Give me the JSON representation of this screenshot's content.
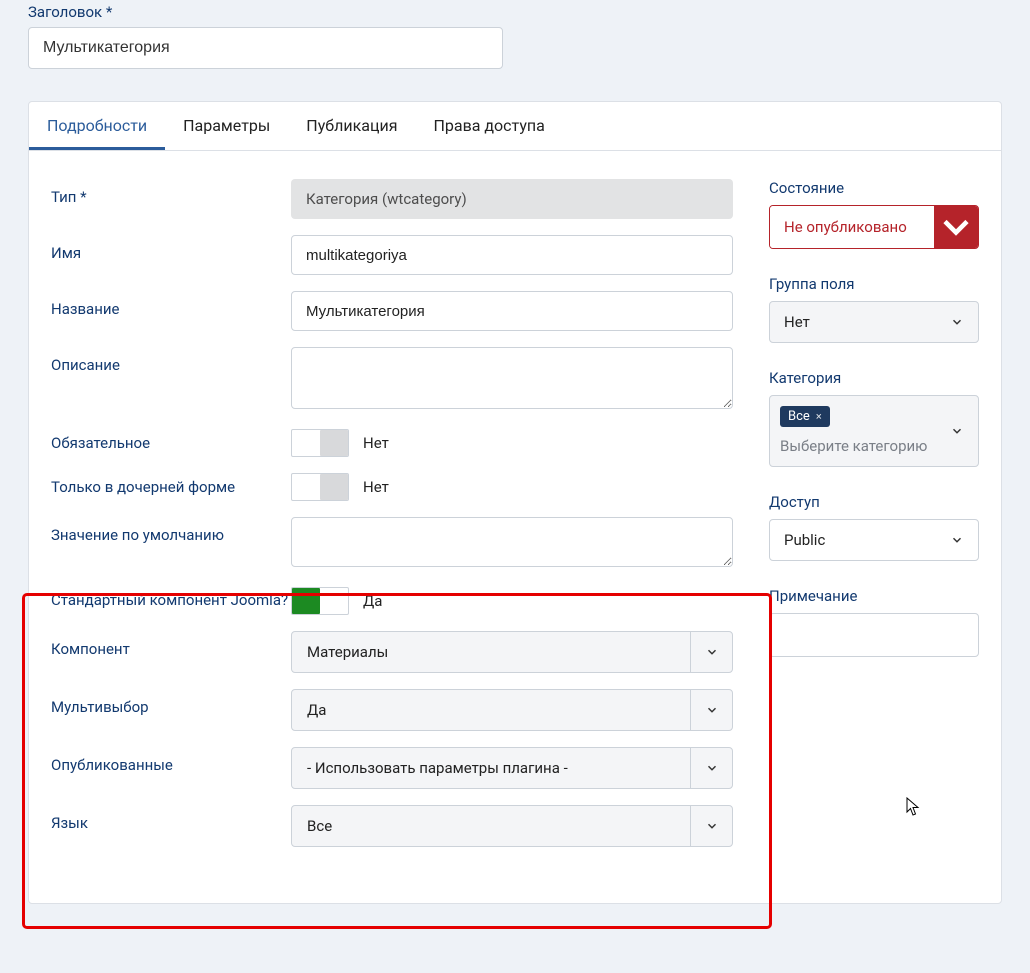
{
  "header": {
    "title_label": "Заголовок *",
    "title_value": "Мультикатегория"
  },
  "tabs": {
    "details": "Подробности",
    "params": "Параметры",
    "publication": "Публикация",
    "permissions": "Права доступа"
  },
  "main": {
    "type_label": "Тип *",
    "type_value": "Категория (wtcategory)",
    "name_label": "Имя",
    "name_value": "multikategoriya",
    "label_label": "Название",
    "label_value": "Мультикатегория",
    "description_label": "Описание",
    "required_label": "Обязательное",
    "required_value": "Нет",
    "subform_only_label": "Только в дочерней форме",
    "subform_only_value": "Нет",
    "default_label": "Значение по умолчанию",
    "std_component_label": "Стандартный компонент Joomla?",
    "std_component_value": "Да",
    "component_label": "Компонент",
    "component_value": "Материалы",
    "multiselect_label": "Мультивыбор",
    "multiselect_value": "Да",
    "published_label": "Опубликованные",
    "published_value": "- Использовать параметры плагина -",
    "language_label": "Язык",
    "language_value": "Все"
  },
  "side": {
    "state_label": "Состояние",
    "state_value": "Не опубликовано",
    "group_label": "Группа поля",
    "group_value": "Нет",
    "category_label": "Категория",
    "category_chip": "Все",
    "category_chip_x": "×",
    "category_placeholder": "Выберите категорию",
    "access_label": "Доступ",
    "access_value": "Public",
    "note_label": "Примечание"
  }
}
